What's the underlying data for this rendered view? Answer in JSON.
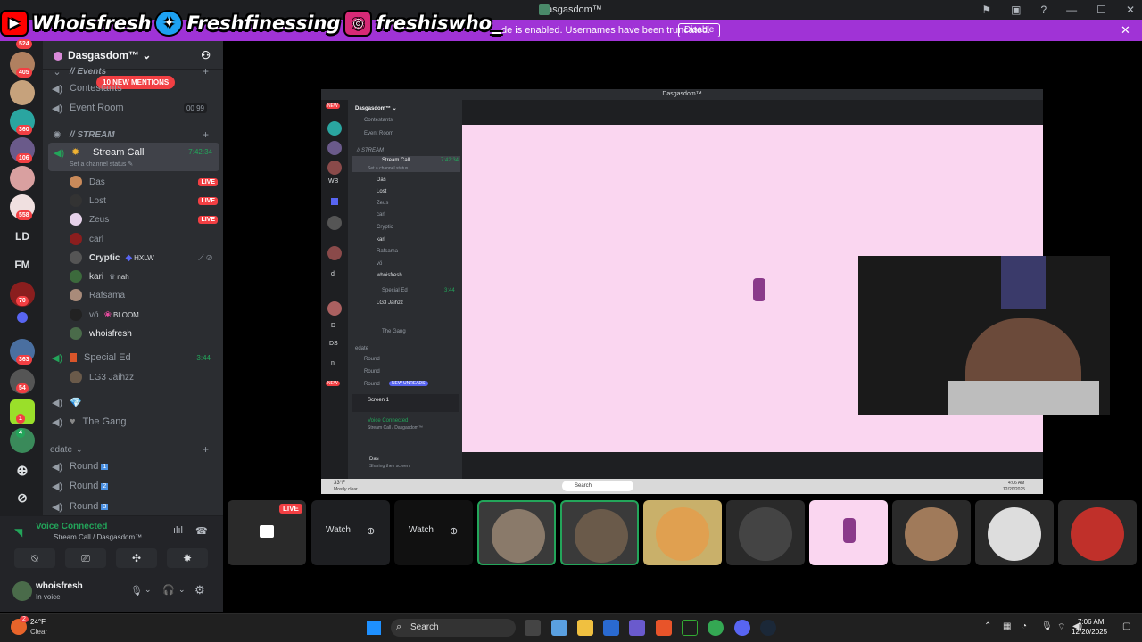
{
  "window": {
    "title": "Dasgasdom™",
    "controls": [
      "—",
      "☐",
      "✕"
    ]
  },
  "social": [
    {
      "platform_icon": "youtube-icon",
      "handle": "Whoisfresh",
      "color": "#ff0000"
    },
    {
      "platform_icon": "twitter-icon",
      "handle": "Freshfinessing",
      "color": "#1da1f2"
    },
    {
      "platform_icon": "instagram-icon",
      "handle": "freshiswho_",
      "color": "#d62976"
    }
  ],
  "banner": {
    "text": "de is enabled. Usernames have been truncated.",
    "disable": "Disable",
    "color": "#a033d6"
  },
  "rail": {
    "badges": [
      "524",
      "405",
      "360",
      "106",
      "558",
      "70",
      "363",
      "54",
      "1",
      "4"
    ],
    "labels": [
      "LD",
      "FM"
    ]
  },
  "guild": {
    "name": "Dasgasdom™ ⌄",
    "mentions": "10 NEW MENTIONS"
  },
  "channels": {
    "events_cat": "// Events",
    "contestants": "Contestants",
    "event_room": "Event Room",
    "event_room_counts": [
      "00",
      "99"
    ],
    "stream_cat": "// STREAM",
    "stream_call": "Stream Call",
    "stream_call_time": "7:42:34",
    "stream_call_status": "Set a channel status ✎",
    "users": [
      {
        "name": "Das",
        "live": "LIVE",
        "color": "#c98a5a"
      },
      {
        "name": "Lost",
        "live": "LIVE",
        "color": "#333333"
      },
      {
        "name": "Zeus",
        "live": "LIVE",
        "color": "#e6d2ea"
      },
      {
        "name": "carl",
        "live": "",
        "color": "#8b1e1e"
      },
      {
        "name": "Cryptic",
        "tag": "HXLW",
        "live": "",
        "color": "#555555"
      },
      {
        "name": "kari",
        "tag": "nah",
        "live": "",
        "color": "#3c6a3c"
      },
      {
        "name": "Rafsama",
        "live": "",
        "color": "#a98b7a"
      },
      {
        "name": "vö",
        "tag": "BLOOM",
        "live": "",
        "color": "#222222"
      },
      {
        "name": "whoisfresh",
        "live": "",
        "color": "#4a6b4a"
      }
    ],
    "special_ed": "Special Ed",
    "special_ed_time": "3:44",
    "special_user": "LG3 Jaihzz",
    "diamond": "💎",
    "the_gang": "The Gang",
    "edate_cat": "edate",
    "rounds": [
      {
        "label": "Round",
        "num": "1"
      },
      {
        "label": "Round",
        "num": "2"
      },
      {
        "label": "Round",
        "num": "3"
      }
    ]
  },
  "voice": {
    "status": "Voice Connected",
    "location": "Stream Call / Dasgasdom™"
  },
  "me": {
    "name": "whoisfresh",
    "status": "In voice"
  },
  "stage": {
    "title": "Dasgasdom™",
    "side": {
      "guild": "Dasgasdom™ ⌄",
      "contestants": "Contestants",
      "event_room": "Event Room",
      "stream_cat": "// STREAM",
      "stream_call": "Stream Call",
      "stream_time": "7:42:34",
      "status": "Set a channel status",
      "users": [
        "Das",
        "Lost",
        "Zeus",
        "carl",
        "Cryptic",
        "kari",
        "Rafsama",
        "vö",
        "whoisfresh"
      ],
      "special_ed": "Special Ed",
      "special_time": "3:44",
      "lg3": "LG3 Jaihzz",
      "gang": "The Gang",
      "edate": "edate",
      "rounds": [
        "Round",
        "Round",
        "Round"
      ],
      "new_unreads": "NEW UNREADS",
      "screen": "Screen 1",
      "voice": "Voice Connected",
      "voice_loc": "Stream Call / Dasgasdom™",
      "das": "Das",
      "das_sub": "Sharing their screen",
      "rail_labels": [
        "WB",
        "d",
        "D",
        "DS",
        "n"
      ],
      "new_badges": [
        "NEW",
        "NEW"
      ]
    },
    "task": {
      "weather": "33°F",
      "weather_sub": "Mostly clear",
      "search": "Search",
      "time": "4:06 AM",
      "date": "12/20/2025"
    }
  },
  "strip": {
    "live": "LIVE",
    "watch": [
      "Watch",
      "Watch"
    ]
  },
  "taskbar": {
    "temp": "24°F",
    "cond": "Clear",
    "search": "Search",
    "time": "7:06 AM",
    "date": "12/20/2025",
    "notif": "2"
  }
}
